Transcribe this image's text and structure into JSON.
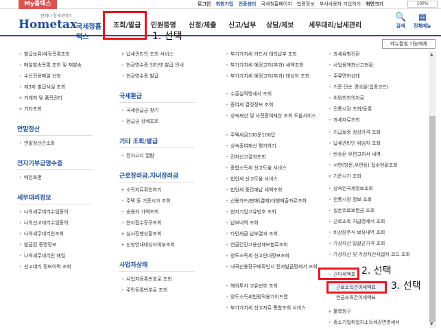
{
  "topbar": {
    "my_tab": "My홈택스",
    "links": [
      "로그인",
      "회원가입",
      "인증센터",
      "국세청홈페이지",
      "법령정보",
      "부서사용자 가입하기",
      "화면크기"
    ],
    "zoom": "100%"
  },
  "header": {
    "logo_small": "언제나 상세서비스",
    "logo_text": "Hometax",
    "logo_ko": "국세청홈택스",
    "nav": [
      "조회/발급",
      "민원증명",
      "신청/제출",
      "신고/납부",
      "상담/제보",
      "세무대리/납세관리"
    ],
    "search": "검색",
    "all_menu": "전체메뉴"
  },
  "menu_toggle": "메뉴펼침 기능해제",
  "annotations": [
    "1. 선택",
    "2. 선택",
    "3. 선택"
  ],
  "col1": {
    "items_top": [
      "발급보류/예정목록조회",
      "메일발송목록 조회 및 재발송",
      "수신전용메일 신청",
      "제3자 발급사실 조회",
      "거래처 및 품목관리",
      "기타조회"
    ],
    "sec_annual": "연말정산",
    "annual_items": [
      "연말정산간소화"
    ],
    "sec_donation": "전자기부금영수증",
    "donation_items": [
      "메인화면"
    ],
    "sec_agent": "세무대리정보",
    "agent_items": [
      "나의세무대리수임동의",
      "나의신고대리수임동의",
      "나의세무대리인조회",
      "발급된 증명정보",
      "나의세무대리인 해임",
      "신고대리 정보이력 조회"
    ]
  },
  "col2": {
    "items_top": [
      "납세관리인 조회 서비스",
      "현금영수증 인터넷 발급 안내",
      "현금영수증 발급"
    ],
    "sec_refund": "국세환급",
    "refund_items": [
      "국세환급금 찾기",
      "환급금 상세조회"
    ],
    "sec_other": "기타 조회/발급",
    "other_items": [
      "전자고지 열람"
    ],
    "sec_earned": "근로장려금.자녀장려금",
    "earned_items": [
      "소득자료확인하기",
      "주택 등 기준시가 조회",
      "승용차 가액조회",
      "현지접수장구조회",
      "심사진행상황조회",
      "신청안내대상자여부조회"
    ],
    "sec_biz": "사업자상태",
    "biz_items": [
      "사업자등록번호로 조회",
      "주민등록번호로 조회"
    ]
  },
  "col3": {
    "items": [
      "부가가치세 카드사 대리납부 조회",
      "부가가치세 예정고지(부과) 세액조회",
      "부가가치세 예정고지(부과) 대상자 조회",
      "수출실적명세서 조회",
      "증여세 결정정보 조회",
      "상속재산 및 사전증여재산 조회 도움서비스",
      "주택세금100문100답",
      "상속증여재산 평가하기",
      "전자신고결과조회",
      "종합소득세 신고도움 서비스",
      "법인세 신고도움 서비스",
      "법인세 중간예납 세액조회",
      "신용카드/판매(결제)대행매출자료조회",
      "현지기업고유번호 조회",
      "납부내역 조회",
      "타인세금 납부결과 조회",
      "연금건강고용산재보험료조회",
      "양도소득세 신고안내정보조회",
      "내국신용장구매확인서 전자발급명세서 조회",
      "해외투자 고유번호 조회",
      "양도소득세법령적용가이드맵",
      "부가가치세 신고자료 통합조회 서비스"
    ]
  },
  "col4": {
    "items_top": [
      "과세유형전환",
      "사업용계좌신고현황",
      "주류면허상태",
      "기준·단순 경비율(업종코드)",
      "위원회회의자료",
      "전통시장 조회/등록",
      "과세자료조회",
      "지급보증 정상가격 조회",
      "납세관리인 위임자 조회",
      "반송된 우편고지서 내역",
      "서면(방문,우편등) 접수현황조회",
      "기준시가 조회",
      "상속인국세정보조회",
      "전통시장 정보 조회",
      "실손의료보험금 조회",
      "근로소득 지급명세서 조회",
      "비상장주식 보유내역 조회",
      "가상자산 일괄군가격 조회",
      "가상자산 및 가상자산사업자 코드 조회"
    ],
    "simple_invoice": "간이세액표",
    "earned_simple": "근로소득간이세액표",
    "pension_simple": "연금소득간이세액표",
    "items_bottom": [
      "불복청구",
      "중소기업취업자소득세감면명세서"
    ]
  }
}
